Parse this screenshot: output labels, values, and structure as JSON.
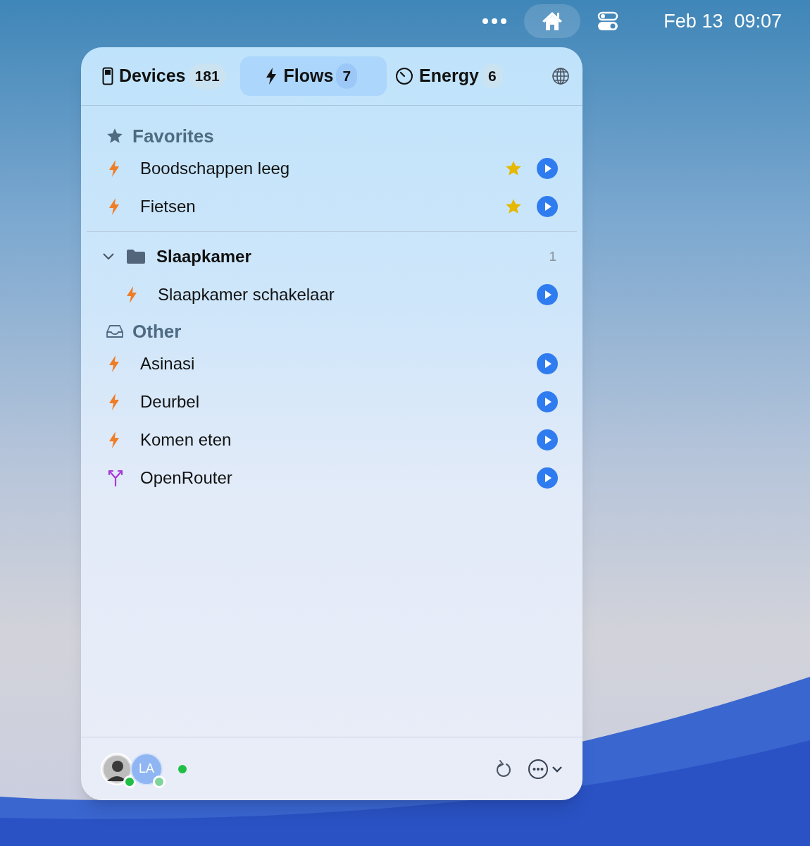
{
  "menu_bar": {
    "date": "Feb 13",
    "time": "09:07"
  },
  "tabs": [
    {
      "label": "Devices",
      "count": "181",
      "kind": "device",
      "selected": false
    },
    {
      "label": "Flows",
      "count": "7",
      "kind": "flow",
      "selected": true
    },
    {
      "label": "Energy",
      "count": "6",
      "kind": "energy",
      "selected": false
    }
  ],
  "favorites": {
    "title": "Favorites",
    "items": [
      {
        "name": "Boodschappen leeg",
        "kind": "flow",
        "starred": true
      },
      {
        "name": "Fietsen",
        "kind": "flow",
        "starred": true
      }
    ]
  },
  "folders": [
    {
      "name": "Slaapkamer",
      "count": "1",
      "expanded": true,
      "children": [
        {
          "name": "Slaapkamer schakelaar",
          "kind": "flow",
          "starred": false
        }
      ]
    }
  ],
  "other": {
    "title": "Other",
    "items": [
      {
        "name": "Asinasi",
        "kind": "flow",
        "starred": false
      },
      {
        "name": "Deurbel",
        "kind": "flow",
        "starred": false
      },
      {
        "name": "Komen eten",
        "kind": "flow",
        "starred": false
      },
      {
        "name": "OpenRouter",
        "kind": "router",
        "starred": false
      }
    ]
  },
  "footer": {
    "users": [
      {
        "kind": "photo",
        "active": true
      },
      {
        "kind": "initials",
        "initials": "LA",
        "active": false
      }
    ],
    "connected": true
  }
}
